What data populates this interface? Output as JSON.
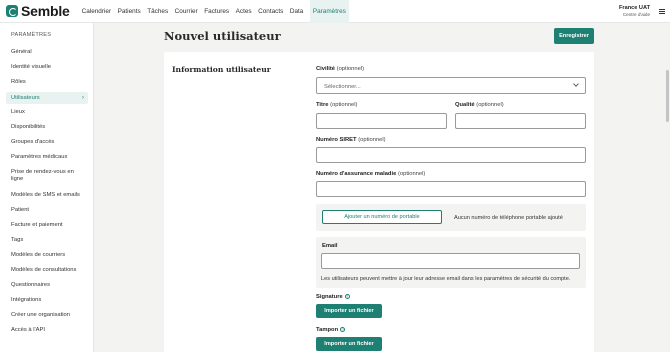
{
  "brand": {
    "name": "Semble",
    "accent": "#1e7f73"
  },
  "nav": {
    "items": [
      "Calendrier",
      "Patients",
      "Tâches",
      "Courrier",
      "Factures",
      "Actes",
      "Contacts",
      "Data",
      "Paramètres"
    ],
    "active": "Paramètres"
  },
  "account": {
    "org": "France UAT",
    "help": "Centre d'aide"
  },
  "sidebar": {
    "title": "PARAMÈTRES",
    "items": [
      "Général",
      "Identité visuelle",
      "Rôles",
      "Utilisateurs",
      "Lieux",
      "Disponibilités",
      "Groupes d'accès",
      "Paramètres médicaux",
      "Prise de rendez-vous en ligne",
      "Modèles de SMS et emails",
      "Patient",
      "Facture et paiement",
      "Tags",
      "Modèles de courriers",
      "Modèles de consultations",
      "Questionnaires",
      "Intégrations",
      "Créer une organisation",
      "Accès à l'API"
    ],
    "active": "Utilisateurs"
  },
  "page": {
    "title": "Nouvel utilisateur",
    "save_label": "Enregistrer",
    "section_title": "Information utilisateur"
  },
  "form": {
    "optional_suffix": "(optionnel)",
    "civility_label": "Civilité",
    "civility_placeholder": "Sélectionner...",
    "title_label": "Titre",
    "quality_label": "Qualité",
    "siret_label": "Numéro SIRET",
    "insurance_label": "Numéro d'assurance maladie",
    "add_phone_label": "Ajouter un numéro de portable",
    "no_phone_text": "Aucun numéro de téléphone portable ajouté",
    "email_label": "Email",
    "email_hint": "Les utilisateurs peuvent mettre à jour leur adresse email dans les paramètres de sécurité du compte.",
    "signature_label": "Signature",
    "stamp_label": "Tampon",
    "import_label": "Importer un fichier"
  }
}
